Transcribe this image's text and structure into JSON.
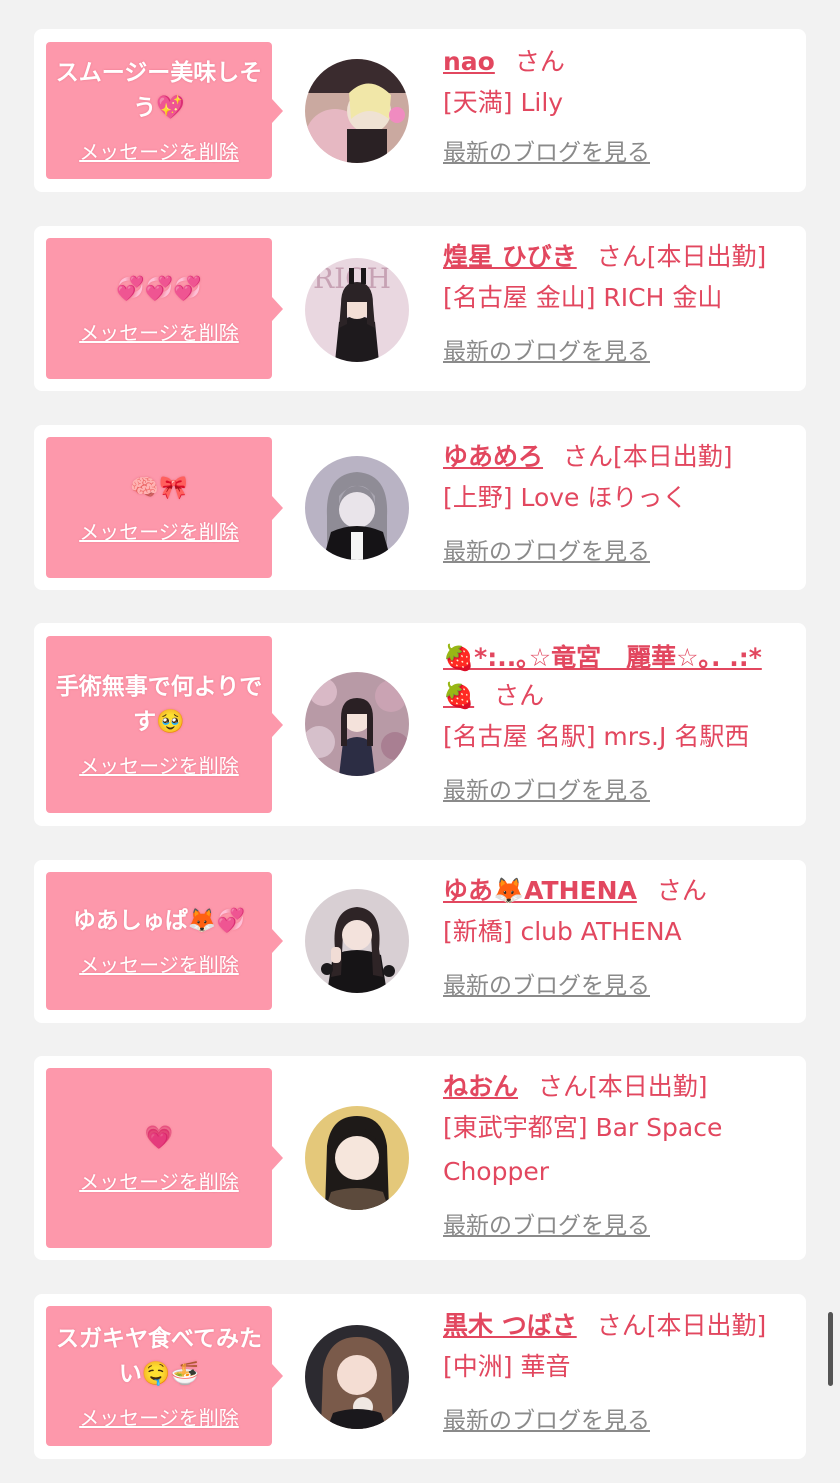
{
  "messages": [
    {
      "text": "スムージー美味しそう💖",
      "delete_label": "メッセージを削除",
      "name": "nao",
      "honorific": "さん",
      "status": "",
      "shop": "[天満] Lily",
      "blog_label": "最新のブログを見る"
    },
    {
      "text": "💞💞💞",
      "delete_label": "メッセージを削除",
      "name": "煌星 ひびき",
      "honorific": "さん",
      "status": "[本日出勤]",
      "shop": "[名古屋 金山] RICH 金山",
      "blog_label": "最新のブログを見る"
    },
    {
      "text": "🧠🎀",
      "delete_label": "メッセージを削除",
      "name": "ゆあめろ",
      "honorific": "さん",
      "status": "[本日出勤]",
      "shop": "[上野] Love ほりっく",
      "blog_label": "最新のブログを見る"
    },
    {
      "text": "手術無事で何よりです🥹",
      "delete_label": "メッセージを削除",
      "name": "🍓*:..｡☆竜宮　麗華☆｡. .:*🍓",
      "honorific": "さん",
      "status": "",
      "shop": "[名古屋 名駅] mrs.J 名駅西",
      "blog_label": "最新のブログを見る"
    },
    {
      "text": "ゆあしゅぱ🦊💞",
      "delete_label": "メッセージを削除",
      "name": "ゆあ🦊ATHENA",
      "honorific": "さん",
      "status": "",
      "shop": "[新橋] club ATHENA",
      "blog_label": "最新のブログを見る"
    },
    {
      "text": "💗",
      "delete_label": "メッセージを削除",
      "name": "ねおん",
      "honorific": "さん",
      "status": "[本日出勤]",
      "shop": "[東武宇都宮] Bar Space Chopper",
      "blog_label": "最新のブログを見る"
    },
    {
      "text": "スガキヤ食べてみたい🤤🍜",
      "delete_label": "メッセージを削除",
      "name": "黒木 つばさ",
      "honorific": "さん",
      "status": "[本日出勤]",
      "shop": "[中洲] 華音",
      "blog_label": "最新のブログを見る"
    }
  ],
  "colors": {
    "accent": "#e2475f",
    "bubble": "#fd98ab",
    "background": "#f2f2f2",
    "link_gray": "#8a8a8a"
  }
}
